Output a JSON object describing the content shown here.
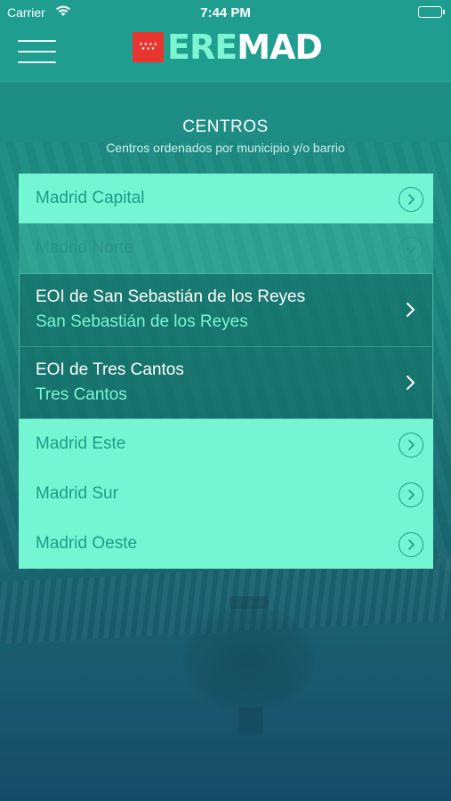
{
  "status_bar": {
    "carrier": "Carrier",
    "time": "7:44 PM",
    "battery_level": 1.0
  },
  "nav": {
    "logo_ere": "ERE",
    "logo_mad": "MAD",
    "menu_icon": "hamburger-icon"
  },
  "header": {
    "title": "CENTROS",
    "subtitle": "Centros ordenados por municipio y/o barrio"
  },
  "regions": [
    {
      "label": "Madrid Capital",
      "expanded": false,
      "icon": "chevron-right-circle-icon"
    },
    {
      "label": "Madrid Norte",
      "expanded": true,
      "icon": "chevron-down-circle-icon"
    },
    {
      "label": "Madrid Este",
      "expanded": false,
      "icon": "chevron-right-circle-icon"
    },
    {
      "label": "Madrid Sur",
      "expanded": false,
      "icon": "chevron-right-circle-icon"
    },
    {
      "label": "Madrid Oeste",
      "expanded": false,
      "icon": "chevron-right-circle-icon"
    }
  ],
  "centers": [
    {
      "name": "EOI de San Sebastián de los Reyes",
      "place": "San Sebastián de los Reyes"
    },
    {
      "name": "EOI de Tres Cantos",
      "place": "Tres Cantos"
    }
  ],
  "colors": {
    "bar": "#1f9e8f",
    "row": "#74f6d2",
    "accent": "#1d9d8a",
    "logo_ere": "#7df5d3",
    "flag": "#e8352f"
  }
}
